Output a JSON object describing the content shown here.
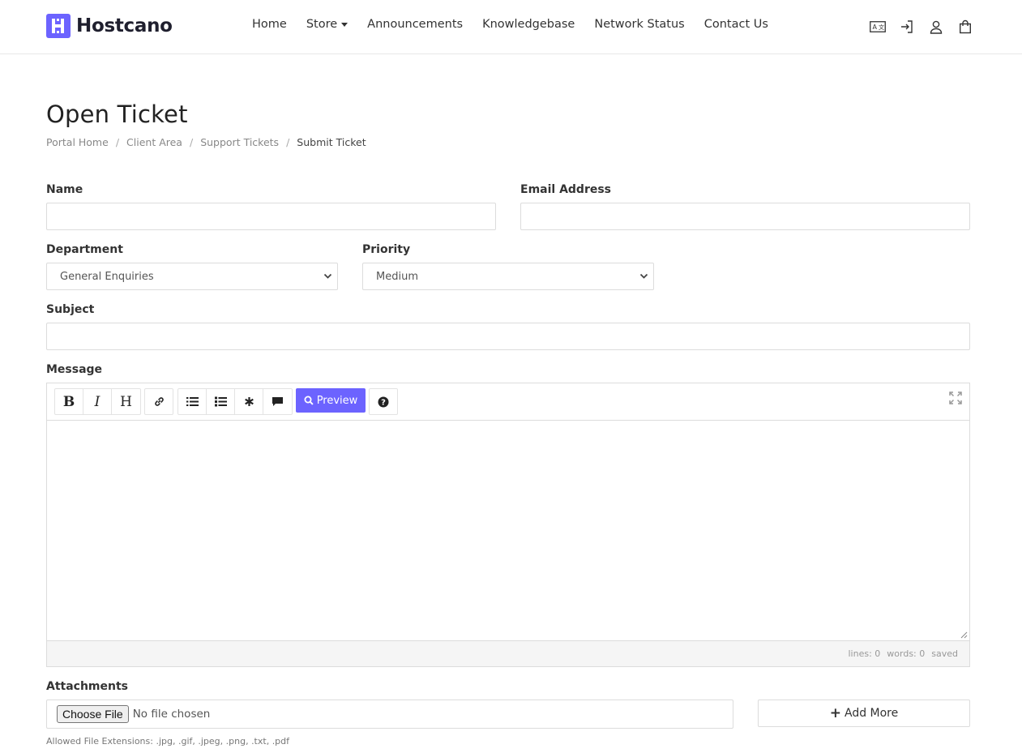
{
  "brand": {
    "name": "Hostcano",
    "accent": "#6c63ff"
  },
  "nav": {
    "items": [
      {
        "label": "Home"
      },
      {
        "label": "Store",
        "dropdown": true
      },
      {
        "label": "Announcements"
      },
      {
        "label": "Knowledgebase"
      },
      {
        "label": "Network Status"
      },
      {
        "label": "Contact Us"
      }
    ],
    "icons": [
      "language-icon",
      "login-icon",
      "user-icon",
      "shopping-bag-icon"
    ]
  },
  "page": {
    "title": "Open Ticket",
    "breadcrumb": [
      "Portal Home",
      "Client Area",
      "Support Tickets",
      "Submit Ticket"
    ]
  },
  "form": {
    "name_label": "Name",
    "name_value": "",
    "email_label": "Email Address",
    "email_value": "",
    "department_label": "Department",
    "department_value": "General Enquiries",
    "priority_label": "Priority",
    "priority_value": "Medium",
    "subject_label": "Subject",
    "subject_value": "",
    "message_label": "Message",
    "attachments_label": "Attachments",
    "choose_file_label": "Choose File",
    "no_file_text": "No file chosen",
    "add_more_label": "Add More",
    "allowed_extensions": "Allowed File Extensions: .jpg, .gif, .jpeg, .png, .txt, .pdf"
  },
  "editor": {
    "toolbar": {
      "bold": "B",
      "italic": "I",
      "heading": "H",
      "preview_label": "Preview"
    },
    "status": {
      "lines": "lines: 0",
      "words": "words: 0",
      "saved": "saved"
    }
  }
}
